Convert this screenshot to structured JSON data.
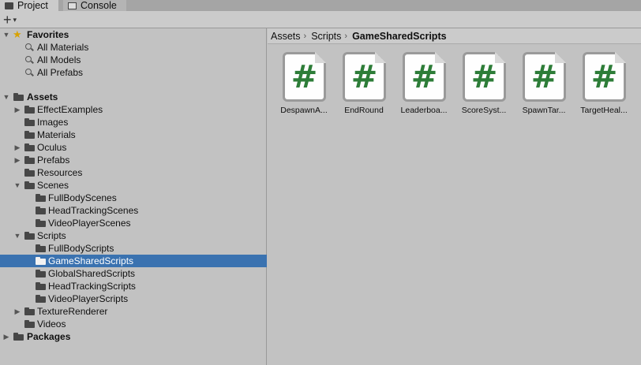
{
  "tabs": [
    {
      "label": "Project",
      "icon": "folder-icon"
    },
    {
      "label": "Console",
      "icon": "console-icon"
    }
  ],
  "toolbar": {
    "add_label": "+",
    "add_arrow": "▾"
  },
  "favorites": {
    "label": "Favorites",
    "items": [
      "All Materials",
      "All Models",
      "All Prefabs"
    ]
  },
  "tree": {
    "assets": "Assets",
    "effect_examples": "EffectExamples",
    "images": "Images",
    "materials": "Materials",
    "oculus": "Oculus",
    "prefabs": "Prefabs",
    "resources": "Resources",
    "scenes": "Scenes",
    "full_body_scenes": "FullBodyScenes",
    "head_tracking_scenes": "HeadTrackingScenes",
    "video_player_scenes": "VideoPlayerScenes",
    "scripts": "Scripts",
    "full_body_scripts": "FullBodyScripts",
    "game_shared_scripts": "GameSharedScripts",
    "global_shared_scripts": "GlobalSharedScripts",
    "head_tracking_scripts": "HeadTrackingScripts",
    "video_player_scripts": "VideoPlayerScripts",
    "texture_renderer": "TextureRenderer",
    "videos": "Videos",
    "packages": "Packages"
  },
  "breadcrumb": [
    "Assets",
    "Scripts",
    "GameSharedScripts"
  ],
  "assets": [
    {
      "name": "DespawnA...",
      "symbol": "#"
    },
    {
      "name": "EndRound",
      "symbol": "#"
    },
    {
      "name": "Leaderboa...",
      "symbol": "#"
    },
    {
      "name": "ScoreSyst...",
      "symbol": "#"
    },
    {
      "name": "SpawnTar...",
      "symbol": "#"
    },
    {
      "name": "TargetHeal...",
      "symbol": "#"
    }
  ],
  "colors": {
    "selection": "#3a72b0",
    "script_icon": "#2d7d38",
    "star": "#d8a200"
  }
}
